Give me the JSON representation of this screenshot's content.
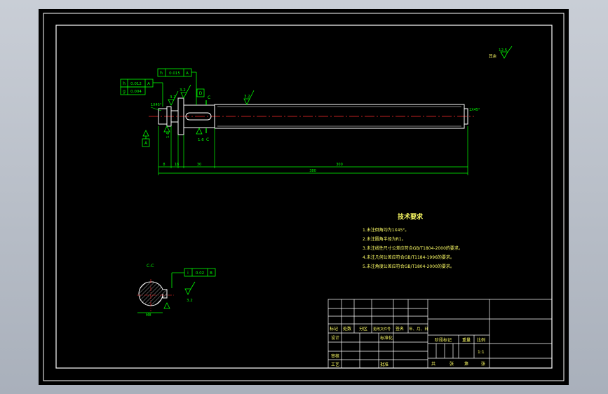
{
  "colors": {
    "frame": "#ffffff",
    "geometry": "#ffffff",
    "dimension": "#00ff00",
    "centerline": "#ff2a2a",
    "text_yellow": "#ffff66",
    "hatch": "#ffffff",
    "background": "#000000"
  },
  "shaft": {
    "chamfer_left": "1X45°",
    "chamfer_right": "1X45°",
    "gtol_h1_sym": "h",
    "gtol_h1_val": "0.012",
    "gtol_h1_ref": "A",
    "gtol_g1_sym": "g",
    "gtol_g1_val": "0.004",
    "gtol_h2_sym": "h",
    "gtol_h2_val": "0.015",
    "gtol_h2_ref": "A",
    "rough_32a": "3.2",
    "rough_32b": "3.2",
    "rough_32c": "3.2",
    "rough_16a": "1.6",
    "rough_16b": "1.6",
    "datum_A": "A",
    "datum_D": "D",
    "section_C_top": "C",
    "section_C_bottom": "C",
    "dim_small1": "8",
    "dim_small2": "18",
    "dim_small3": "30",
    "dim_mid": "300",
    "dim_total": "380"
  },
  "surface_finish": {
    "value": "12.5",
    "label": "其余"
  },
  "tech_req": {
    "title": "技术要求",
    "items": [
      "1.未注倒角均为1X45°。",
      "2.未注圆角半径为R1。",
      "3.未注线性尺寸公差应符合GB/T1804-2000的要求。",
      "4.未注几何公差应符合GB/T1184-1996的要求。",
      "5.未注角度公差应符合GB/T1804-2000的要求。"
    ]
  },
  "section": {
    "label": "C-C",
    "gtol_sym": "i",
    "gtol_val": "0.02",
    "gtol_ref": "B",
    "rough": "3.2",
    "dim": "M8"
  },
  "title_block": {
    "h_mark": "标记",
    "h_count": "处数",
    "h_zone": "分区",
    "h_docno": "更改文件号",
    "h_sign": "签名",
    "h_date": "年、月、日",
    "design": "设计",
    "std": "标准化",
    "review": "审核",
    "process": "工艺",
    "approve": "批准",
    "stage": "阶段标记",
    "weight": "重量",
    "scale_label": "比例",
    "scale_val": "1:1",
    "total": "共",
    "sheets": "张",
    "page": "第",
    "page_sheets": "张"
  }
}
